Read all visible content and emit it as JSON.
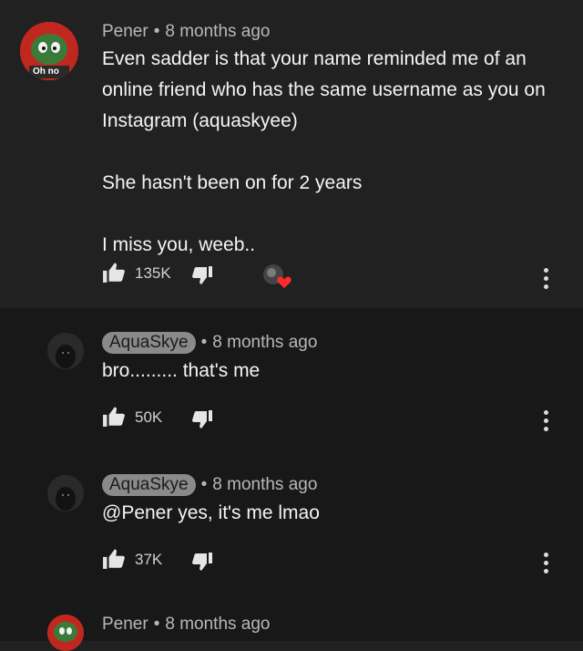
{
  "comments": [
    {
      "author": "Pener",
      "time": "8 months ago",
      "avatar_badge": "Oh no",
      "lines": [
        "Even sadder is that your name reminded me of an",
        "online friend who has the same username as you on",
        "Instagram (aquaskyee)",
        "",
        "She hasn't been on for 2 years",
        "",
        "I miss you, weeb.."
      ],
      "likes": "135K"
    },
    {
      "author": "AquaSkye",
      "time": "8 months ago",
      "text": "bro......... that's me",
      "likes": "50K"
    },
    {
      "author": "AquaSkye",
      "time": "8 months ago",
      "text": "@Pener yes, it's me lmao",
      "likes": "37K"
    },
    {
      "author": "Pener",
      "time": "8 months ago"
    }
  ],
  "separator": "•",
  "colors": {
    "background": "#212121",
    "reply_background": "#181818",
    "heart": "#ff2b2b",
    "author_chip": "#8a8a8a"
  }
}
